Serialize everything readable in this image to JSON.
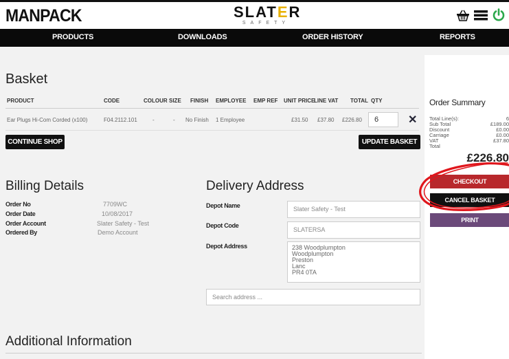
{
  "header": {
    "brand": "MANPACK",
    "logo_main_1": "SLAT",
    "logo_main_e": "E",
    "logo_main_2": "R",
    "logo_sub": "SAFETY",
    "icons": [
      "basket-icon",
      "menu-icon",
      "power-icon"
    ]
  },
  "nav": {
    "items": [
      "PRODUCTS",
      "DOWNLOADS",
      "ORDER HISTORY",
      "REPORTS"
    ]
  },
  "basket": {
    "title": "Basket",
    "columns": [
      "PRODUCT",
      "CODE",
      "COLOUR",
      "SIZE",
      "FINISH",
      "EMPLOYEE",
      "EMP REF",
      "UNIT PRICE",
      "LINE VAT",
      "TOTAL",
      "QTY"
    ],
    "rows": [
      {
        "product": "Ear Plugs Hi-Com Corded (x100)",
        "code": "F04.2112.101",
        "colour": "-",
        "size": "-",
        "finish": "No Finish",
        "employee": "1 Employee",
        "emp_ref": "",
        "unit_price": "£31.50",
        "line_vat": "£37.80",
        "total": "£226.80",
        "qty": "6"
      }
    ],
    "continue_label": "CONTINUE SHOP",
    "update_label": "UPDATE BASKET"
  },
  "billing": {
    "title": "Billing Details",
    "order_no_label": "Order No",
    "order_no": "7709WC",
    "order_date_label": "Order Date",
    "order_date": "10/08/2017",
    "order_account_label": "Order Account",
    "order_account": "Slater Safety - Test",
    "ordered_by_label": "Ordered By",
    "ordered_by": "Demo Account"
  },
  "delivery": {
    "title": "Delivery Address",
    "depot_name_label": "Depot Name",
    "depot_name": "Slater Safety - Test",
    "depot_code_label": "Depot Code",
    "depot_code": "SLATERSA",
    "depot_address_label": "Depot Address",
    "address_lines": [
      "238 Woodplumpton",
      "Woodplumpton",
      "Preston",
      "Lanc",
      "PR4 0TA"
    ],
    "search_placeholder": "Search address ..."
  },
  "summary": {
    "title": "Order Summary",
    "rows": [
      {
        "label": "Total Line(s):",
        "value": "6"
      },
      {
        "label": "Sub Total",
        "value": "£189.00"
      },
      {
        "label": "Discount",
        "value": "£0.00"
      },
      {
        "label": "Carriage",
        "value": "£0.00"
      },
      {
        "label": "VAT",
        "value": "£37.80"
      },
      {
        "label": "Total",
        "value": ""
      }
    ],
    "total": "£226.80",
    "checkout_label": "CHECKOUT",
    "cancel_label": "CANCEL BASKET",
    "print_label": "PRINT"
  },
  "additional": {
    "title": "Additional Information"
  },
  "colors": {
    "checkout": "#b8282c",
    "cancel": "#111111",
    "print": "#6b4a7a",
    "annotation": "#e0161c",
    "logo_accent": "#e8b100"
  }
}
